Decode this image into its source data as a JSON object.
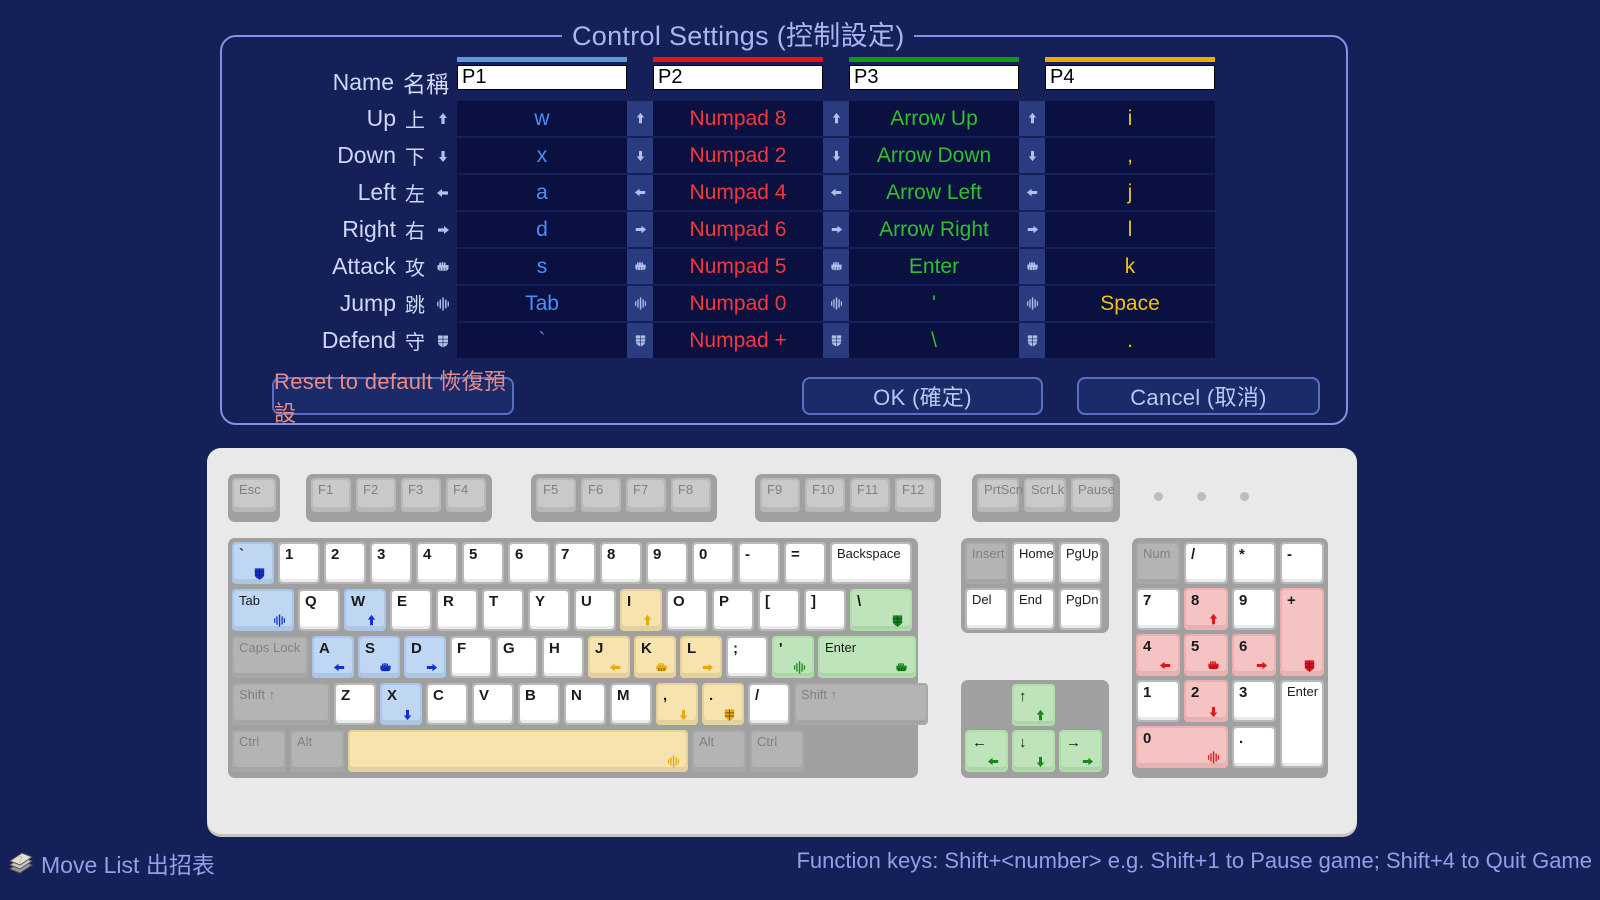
{
  "dialog": {
    "title": "Control Settings (控制設定)",
    "row_labels": [
      {
        "en": "Name",
        "zh": "名稱",
        "icon": ""
      },
      {
        "en": "Up",
        "zh": "上",
        "icon": "arrow-up-icon"
      },
      {
        "en": "Down",
        "zh": "下",
        "icon": "arrow-down-icon"
      },
      {
        "en": "Left",
        "zh": "左",
        "icon": "arrow-left-icon"
      },
      {
        "en": "Right",
        "zh": "右",
        "icon": "arrow-right-icon"
      },
      {
        "en": "Attack",
        "zh": "攻",
        "icon": "fist-icon"
      },
      {
        "en": "Jump",
        "zh": "跳",
        "icon": "jump-icon"
      },
      {
        "en": "Defend",
        "zh": "守",
        "icon": "shield-icon"
      }
    ],
    "players": [
      {
        "name": "P1",
        "color": "#5b9bd5",
        "up": "w",
        "down": "x",
        "left": "a",
        "right": "d",
        "attack": "s",
        "jump": "Tab",
        "defend": "`"
      },
      {
        "name": "P2",
        "color": "#ee1111",
        "up": "Numpad 8",
        "down": "Numpad 2",
        "left": "Numpad 4",
        "right": "Numpad 6",
        "attack": "Numpad 5",
        "jump": "Numpad 0",
        "defend": "Numpad +"
      },
      {
        "name": "P3",
        "color": "#119911",
        "up": "Arrow Up",
        "down": "Arrow Down",
        "left": "Arrow Left",
        "right": "Arrow Right",
        "attack": "Enter",
        "jump": "'",
        "defend": "\\"
      },
      {
        "name": "P4",
        "color": "#f0a800",
        "up": "i",
        "down": ",",
        "left": "j",
        "right": "l",
        "attack": "k",
        "jump": "Space",
        "defend": "."
      }
    ],
    "buttons": {
      "reset": "Reset to default 恢復預設",
      "ok": "OK (確定)",
      "cancel": "Cancel (取消)"
    }
  },
  "keyboard": {
    "fn_row": {
      "esc": "Esc",
      "f1_4": [
        "F1",
        "F2",
        "F3",
        "F4"
      ],
      "f5_8": [
        "F5",
        "F6",
        "F7",
        "F8"
      ],
      "f9_12": [
        "F9",
        "F10",
        "F11",
        "F12"
      ],
      "sys": [
        "PrtScn",
        "ScrLk",
        "Pause"
      ]
    },
    "main_rows": [
      [
        {
          "label": "`",
          "bind": "shield-icon",
          "player": 1
        },
        {
          "label": "1"
        },
        {
          "label": "2"
        },
        {
          "label": "3"
        },
        {
          "label": "4"
        },
        {
          "label": "5"
        },
        {
          "label": "6"
        },
        {
          "label": "7"
        },
        {
          "label": "8"
        },
        {
          "label": "9"
        },
        {
          "label": "0"
        },
        {
          "label": "-"
        },
        {
          "label": "="
        },
        {
          "label": "Backspace"
        }
      ],
      [
        {
          "label": "Tab",
          "bind": "jump-icon",
          "player": 1
        },
        {
          "label": "Q"
        },
        {
          "label": "W",
          "bind": "arrow-up-icon",
          "player": 1
        },
        {
          "label": "E"
        },
        {
          "label": "R"
        },
        {
          "label": "T"
        },
        {
          "label": "Y"
        },
        {
          "label": "U"
        },
        {
          "label": "I",
          "bind": "arrow-up-icon",
          "player": 4
        },
        {
          "label": "O"
        },
        {
          "label": "P"
        },
        {
          "label": "["
        },
        {
          "label": "]"
        },
        {
          "label": "\\",
          "bind": "shield-icon",
          "player": 3
        }
      ],
      [
        {
          "label": "Caps Lock"
        },
        {
          "label": "A",
          "bind": "arrow-left-icon",
          "player": 1
        },
        {
          "label": "S",
          "bind": "fist-icon",
          "player": 1
        },
        {
          "label": "D",
          "bind": "arrow-right-icon",
          "player": 1
        },
        {
          "label": "F"
        },
        {
          "label": "G"
        },
        {
          "label": "H"
        },
        {
          "label": "J",
          "bind": "arrow-left-icon",
          "player": 4
        },
        {
          "label": "K",
          "bind": "fist-icon",
          "player": 4
        },
        {
          "label": "L",
          "bind": "arrow-right-icon",
          "player": 4
        },
        {
          "label": ";"
        },
        {
          "label": "'",
          "bind": "jump-icon",
          "player": 3
        },
        {
          "label": "Enter",
          "bind": "fist-icon",
          "player": 3
        }
      ],
      [
        {
          "label": "Shift ↑"
        },
        {
          "label": "Z"
        },
        {
          "label": "X",
          "bind": "arrow-down-icon",
          "player": 1
        },
        {
          "label": "C"
        },
        {
          "label": "V"
        },
        {
          "label": "B"
        },
        {
          "label": "N"
        },
        {
          "label": "M"
        },
        {
          "label": ",",
          "bind": "arrow-down-icon",
          "player": 4
        },
        {
          "label": ".",
          "bind": "shield-icon",
          "player": 4
        },
        {
          "label": "/"
        },
        {
          "label": "Shift ↑"
        }
      ],
      [
        {
          "label": "Ctrl"
        },
        {
          "label": "Alt"
        },
        {
          "label": "",
          "bind": "jump-icon",
          "player": 4
        },
        {
          "label": "Alt"
        },
        {
          "label": "Ctrl"
        }
      ]
    ],
    "nav_cluster": [
      {
        "label": "Insert"
      },
      {
        "label": "Home"
      },
      {
        "label": "PgUp"
      },
      {
        "label": "Del"
      },
      {
        "label": "End"
      },
      {
        "label": "PgDn"
      }
    ],
    "arrow_cluster": [
      {
        "label": "↑",
        "bind": "arrow-up-icon",
        "player": 3
      },
      {
        "label": "←",
        "bind": "arrow-left-icon",
        "player": 3
      },
      {
        "label": "↓",
        "bind": "arrow-down-icon",
        "player": 3
      },
      {
        "label": "→",
        "bind": "arrow-right-icon",
        "player": 3
      }
    ],
    "numpad": [
      {
        "label": "Num"
      },
      {
        "label": "/"
      },
      {
        "label": "*"
      },
      {
        "label": "-"
      },
      {
        "label": "7"
      },
      {
        "label": "8",
        "bind": "arrow-up-icon",
        "player": 2
      },
      {
        "label": "9"
      },
      {
        "label": "+",
        "bind": "shield-icon",
        "player": 2
      },
      {
        "label": "4",
        "bind": "arrow-left-icon",
        "player": 2
      },
      {
        "label": "5",
        "bind": "fist-icon",
        "player": 2
      },
      {
        "label": "6",
        "bind": "arrow-right-icon",
        "player": 2
      },
      {
        "label": "1"
      },
      {
        "label": "2",
        "bind": "arrow-down-icon",
        "player": 2
      },
      {
        "label": "3"
      },
      {
        "label": "Enter"
      },
      {
        "label": "0",
        "bind": "jump-icon",
        "player": 2
      },
      {
        "label": "."
      }
    ]
  },
  "bottom": {
    "move_list": "Move List 出招表",
    "function_keys_hint": "Function keys: Shift+<number>   e.g. Shift+1 to Pause game; Shift+4 to Quit Game"
  }
}
